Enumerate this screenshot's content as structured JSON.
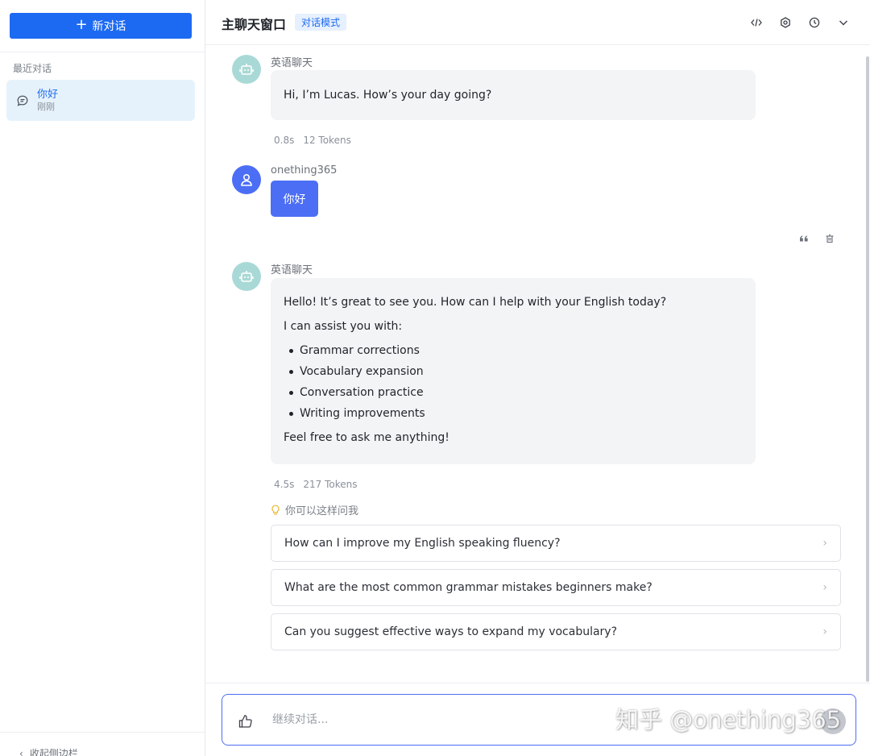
{
  "sidebar": {
    "new_chat_label": "新对话",
    "recent_label": "最近对话",
    "conversations": [
      {
        "title": "你好",
        "time": "刚刚"
      }
    ],
    "collapse_label": "收起侧边栏"
  },
  "header": {
    "title": "主聊天窗口",
    "mode_badge": "对话模式",
    "icons": [
      "code-icon",
      "settings-icon",
      "history-icon",
      "chevron-down-icon"
    ]
  },
  "messages": [
    {
      "role": "bot",
      "sender": "英语聊天",
      "text": "Hi, I’m Lucas. How’s your day going?",
      "time": "0.8s",
      "tokens": "12 Tokens"
    },
    {
      "role": "user",
      "sender": "onething365",
      "text": "你好"
    },
    {
      "role": "bot",
      "sender": "英语聊天",
      "intro": "Hello! It’s great to see you. How can I help with your English today?",
      "lead": "I can assist you with:",
      "bullets": [
        "Grammar corrections",
        "Vocabulary expansion",
        "Conversation practice",
        "Writing improvements"
      ],
      "outro": "Feel free to ask me anything!",
      "time": "4.5s",
      "tokens": "217 Tokens"
    }
  ],
  "suggestions": {
    "label": "你可以这样问我",
    "items": [
      "How can I improve my English speaking fluency?",
      "What are the most common grammar mistakes beginners make?",
      "Can you suggest effective ways to expand my vocabulary?"
    ]
  },
  "input": {
    "placeholder": "继续对话...",
    "value": ""
  },
  "watermark": "知乎 @onething365",
  "colors": {
    "accent": "#1d6af2",
    "user_bubble": "#4c6ef5",
    "bot_avatar": "#a9d9d6"
  }
}
